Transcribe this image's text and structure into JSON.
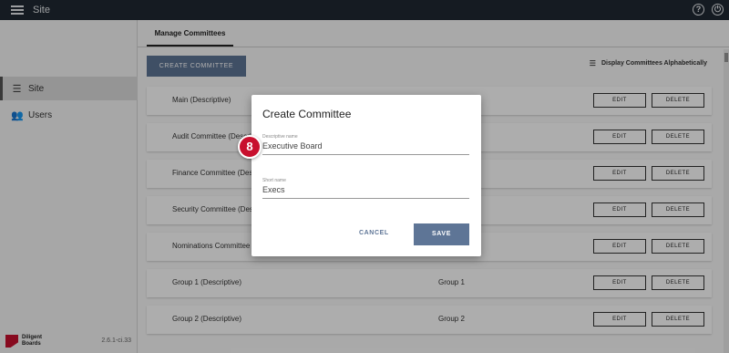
{
  "header": {
    "app_title": "Site",
    "help_icon": "help-icon",
    "power_icon": "power-icon"
  },
  "sidebar": {
    "items": [
      {
        "label": "Site",
        "icon": "list-icon",
        "active": true
      },
      {
        "label": "Users",
        "icon": "users-icon",
        "active": false
      }
    ],
    "brand_line1": "Diligent",
    "brand_line2": "Boards",
    "version": "2.6.1-ci.33"
  },
  "main": {
    "tab_label": "Manage Committees",
    "create_button": "CREATE COMMITTEE",
    "sort_label": "Display Committees Alphabetically",
    "edit_label": "EDIT",
    "delete_label": "DELETE",
    "rows": [
      {
        "name": "Main (Descriptive)",
        "short": ""
      },
      {
        "name": "Audit Committee (Descriptive)",
        "short": ""
      },
      {
        "name": "Finance Committee (Descriptive)",
        "short": ""
      },
      {
        "name": "Security Committee (Descriptive)",
        "short": ""
      },
      {
        "name": "Nominations Committee (Descriptive)",
        "short": ""
      },
      {
        "name": "Group 1 (Descriptive)",
        "short": "Group 1"
      },
      {
        "name": "Group 2 (Descriptive)",
        "short": "Group 2"
      }
    ]
  },
  "dialog": {
    "title": "Create Committee",
    "descriptive_label": "Descriptive name",
    "descriptive_value": "Executive Board",
    "short_label": "Short name",
    "short_value": "Execs",
    "cancel_label": "CANCEL",
    "save_label": "SAVE"
  },
  "step_badge": "8",
  "colors": {
    "topbar": "#1f2933",
    "accent": "#5e7596",
    "badge": "#c8102e"
  }
}
